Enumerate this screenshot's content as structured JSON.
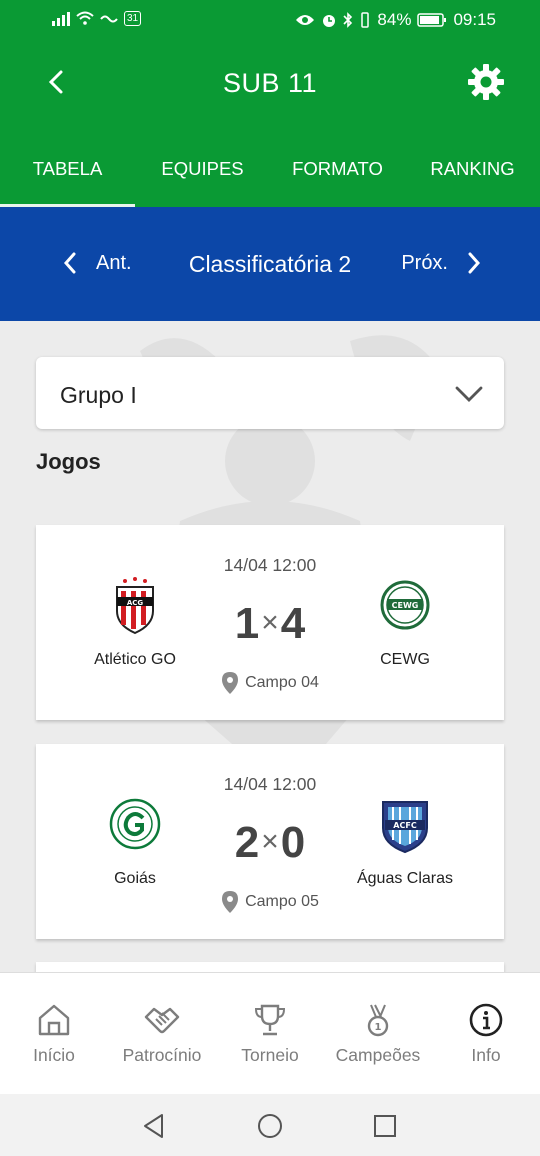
{
  "status_bar": {
    "left_badge": "31",
    "battery": "84%",
    "time": "09:15"
  },
  "header": {
    "title": "SUB 11"
  },
  "tabs": [
    {
      "label": "TABELA",
      "active": true
    },
    {
      "label": "EQUIPES",
      "active": false
    },
    {
      "label": "FORMATO",
      "active": false
    },
    {
      "label": "RANKING",
      "active": false
    }
  ],
  "phase": {
    "prev_label": "Ant.",
    "name": "Classificatória 2",
    "next_label": "Próx."
  },
  "group_select": {
    "value": "Grupo I"
  },
  "section": {
    "title": "Jogos"
  },
  "matches": [
    {
      "datetime": "14/04 12:00",
      "home": {
        "name": "Atlético GO",
        "score": "1",
        "crest_icon": "atletico-go-crest-icon"
      },
      "away": {
        "name": "CEWG",
        "score": "4",
        "crest_icon": "cewg-crest-icon"
      },
      "separator": "×",
      "venue": "Campo 04"
    },
    {
      "datetime": "14/04 12:00",
      "home": {
        "name": "Goiás",
        "score": "2",
        "crest_icon": "goias-crest-icon"
      },
      "away": {
        "name": "Águas Claras",
        "score": "0",
        "crest_icon": "aguas-claras-crest-icon"
      },
      "separator": "×",
      "venue": "Campo 05"
    }
  ],
  "bottom_nav": [
    {
      "label": "Início",
      "icon": "home-icon"
    },
    {
      "label": "Patrocínio",
      "icon": "handshake-icon"
    },
    {
      "label": "Torneio",
      "icon": "trophy-icon"
    },
    {
      "label": "Campeões",
      "icon": "medal-icon"
    },
    {
      "label": "Info",
      "icon": "info-icon"
    }
  ],
  "colors": {
    "primary_green": "#0a9a34",
    "phase_blue": "#0c47a8",
    "background": "#ececec"
  }
}
